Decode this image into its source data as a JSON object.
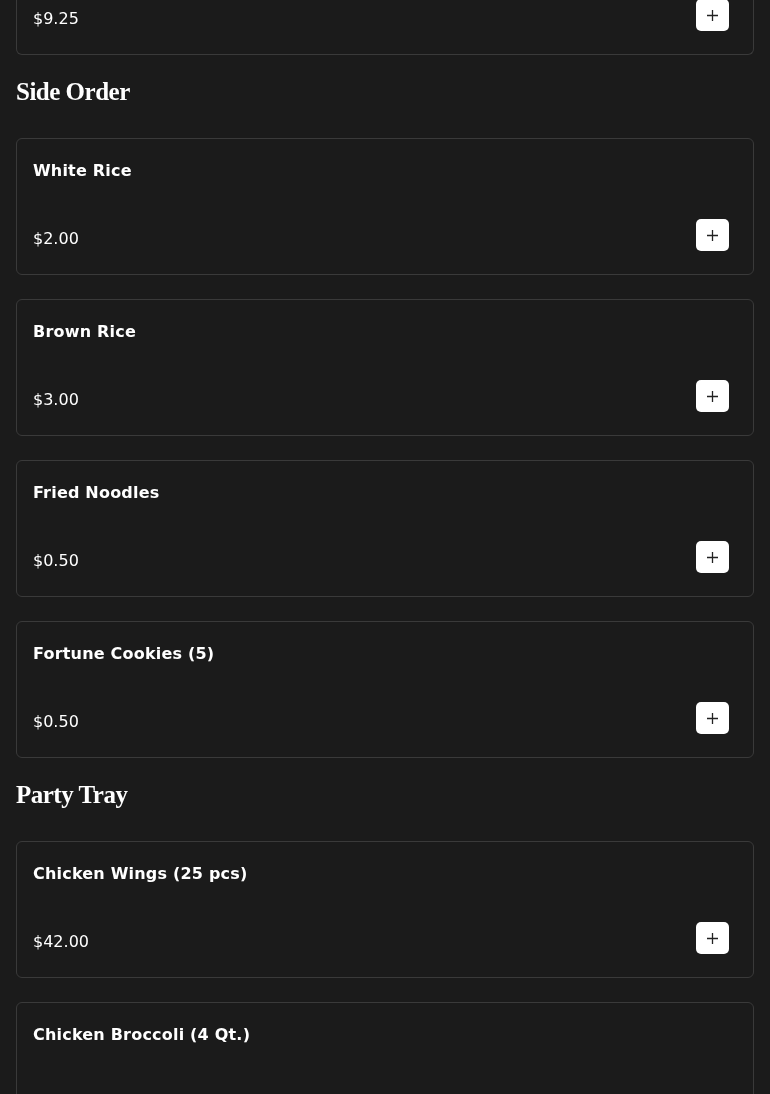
{
  "sections": [
    {
      "items": [
        {
          "price": "$9.25"
        }
      ]
    },
    {
      "title": "Side Order",
      "items": [
        {
          "name": "White Rice",
          "price": "$2.00"
        },
        {
          "name": "Brown Rice",
          "price": "$3.00"
        },
        {
          "name": "Fried Noodles",
          "price": "$0.50"
        },
        {
          "name": "Fortune Cookies (5)",
          "price": "$0.50"
        }
      ]
    },
    {
      "title": "Party Tray",
      "items": [
        {
          "name": "Chicken Wings (25 pcs)",
          "price": "$42.00"
        },
        {
          "name": "Chicken Broccoli (4 Qt.)"
        }
      ]
    }
  ]
}
